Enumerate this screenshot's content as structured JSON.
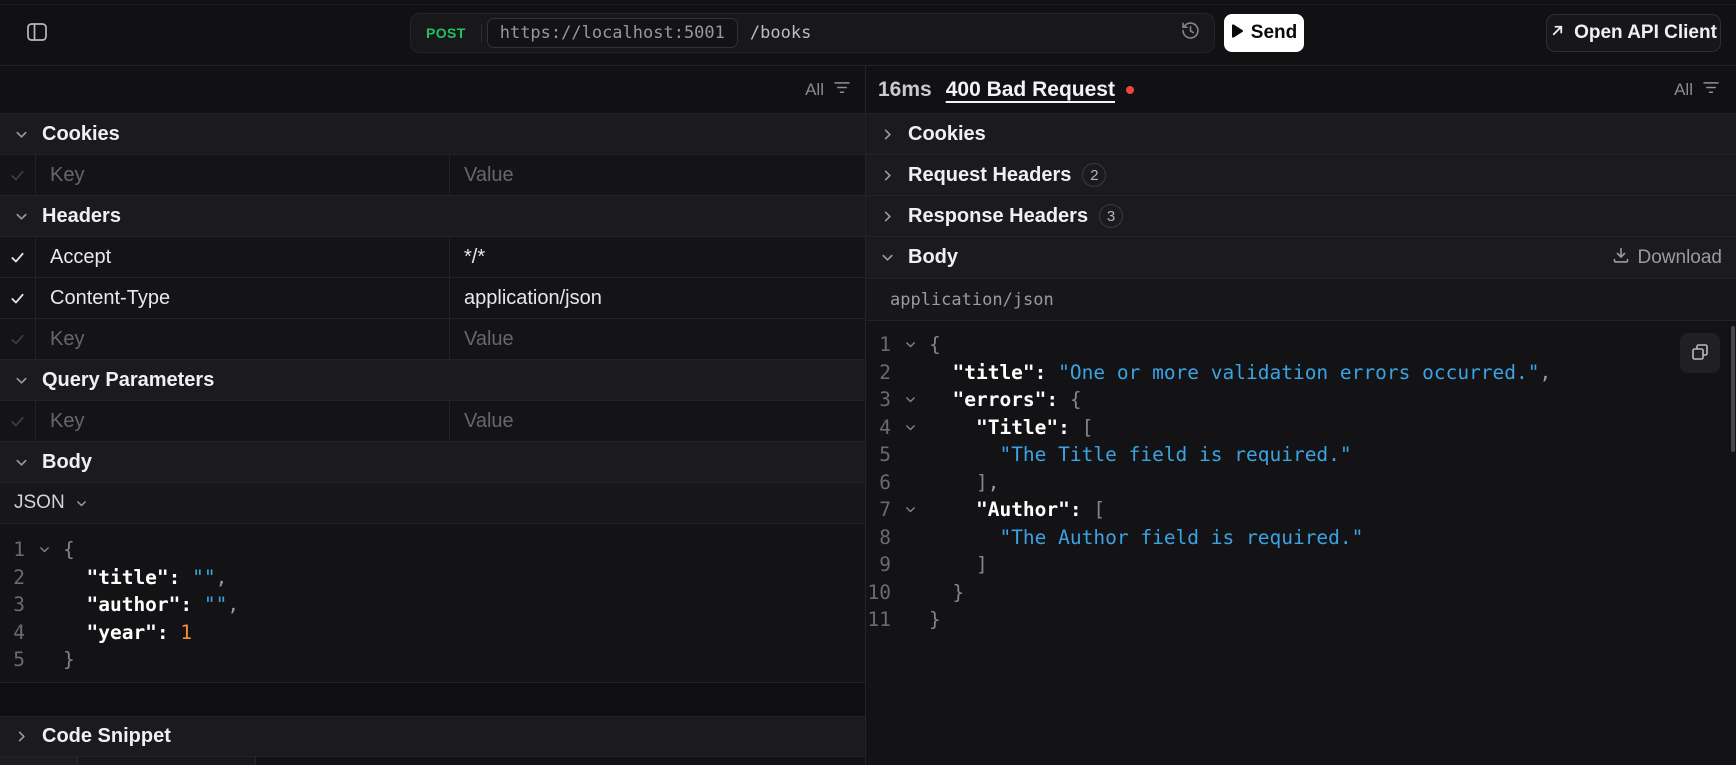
{
  "topbar": {
    "method": "POST",
    "base_url": "https://localhost:5001",
    "path": "/books",
    "send_label": "Send",
    "open_api_client_label": "Open API Client"
  },
  "request_panel": {
    "filter_label": "All",
    "placeholders": {
      "key": "Key",
      "value": "Value"
    },
    "sections": {
      "cookies": {
        "title": "Cookies",
        "rows": [
          {
            "key": "",
            "value": "",
            "checked": false
          }
        ]
      },
      "headers": {
        "title": "Headers",
        "rows": [
          {
            "key": "Accept",
            "value": "*/*",
            "checked": true
          },
          {
            "key": "Content-Type",
            "value": "application/json",
            "checked": true
          },
          {
            "key": "",
            "value": "",
            "checked": false
          }
        ]
      },
      "query_parameters": {
        "title": "Query Parameters",
        "rows": [
          {
            "key": "",
            "value": "",
            "checked": false
          }
        ]
      },
      "body": {
        "title": "Body",
        "format_selector": "JSON"
      },
      "code_snippet": {
        "title": "Code Snippet"
      }
    },
    "body_code": [
      {
        "n": 1,
        "fold": true,
        "ind": 0,
        "seg": [
          [
            "{",
            "brace"
          ]
        ]
      },
      {
        "n": 2,
        "ind": 2,
        "seg": [
          [
            "\"title\":",
            "key"
          ],
          [
            " ",
            "punc"
          ],
          [
            "\"\"",
            "str"
          ],
          [
            ",",
            "punc"
          ]
        ]
      },
      {
        "n": 3,
        "ind": 2,
        "seg": [
          [
            "\"author\":",
            "key"
          ],
          [
            " ",
            "punc"
          ],
          [
            "\"\"",
            "str"
          ],
          [
            ",",
            "punc"
          ]
        ]
      },
      {
        "n": 4,
        "ind": 2,
        "seg": [
          [
            "\"year\":",
            "key"
          ],
          [
            " ",
            "punc"
          ],
          [
            "1",
            "num"
          ]
        ]
      },
      {
        "n": 5,
        "ind": 0,
        "seg": [
          [
            "}",
            "brace"
          ]
        ]
      }
    ]
  },
  "response_panel": {
    "duration": "16ms",
    "status": "400 Bad Request",
    "filter_label": "All",
    "sections": {
      "cookies": {
        "title": "Cookies"
      },
      "request_headers": {
        "title": "Request Headers",
        "count": "2"
      },
      "response_headers": {
        "title": "Response Headers",
        "count": "3"
      },
      "body": {
        "title": "Body",
        "download_label": "Download",
        "content_type": "application/json"
      }
    },
    "body_code": [
      {
        "n": 1,
        "fold": true,
        "ind": 0,
        "seg": [
          [
            "{",
            "brace"
          ]
        ]
      },
      {
        "n": 2,
        "ind": 2,
        "seg": [
          [
            "\"title\":",
            "key"
          ],
          [
            " ",
            "punc"
          ],
          [
            "\"One or more validation errors occurred.\"",
            "str"
          ],
          [
            ",",
            "punc"
          ]
        ]
      },
      {
        "n": 3,
        "fold": true,
        "ind": 2,
        "seg": [
          [
            "\"errors\":",
            "key"
          ],
          [
            " ",
            "punc"
          ],
          [
            "{",
            "brace"
          ]
        ]
      },
      {
        "n": 4,
        "fold": true,
        "ind": 4,
        "seg": [
          [
            "\"Title\":",
            "key"
          ],
          [
            " ",
            "punc"
          ],
          [
            "[",
            "brace"
          ]
        ]
      },
      {
        "n": 5,
        "ind": 6,
        "seg": [
          [
            "\"The Title field is required.\"",
            "str"
          ]
        ]
      },
      {
        "n": 6,
        "ind": 4,
        "seg": [
          [
            "]",
            "brace"
          ],
          [
            ",",
            "punc"
          ]
        ]
      },
      {
        "n": 7,
        "fold": true,
        "ind": 4,
        "seg": [
          [
            "\"Author\":",
            "key"
          ],
          [
            " ",
            "punc"
          ],
          [
            "[",
            "brace"
          ]
        ]
      },
      {
        "n": 8,
        "ind": 6,
        "seg": [
          [
            "\"The Author field is required.\"",
            "str"
          ]
        ]
      },
      {
        "n": 9,
        "ind": 4,
        "seg": [
          [
            "]",
            "brace"
          ]
        ]
      },
      {
        "n": 10,
        "ind": 2,
        "seg": [
          [
            "}",
            "brace"
          ]
        ]
      },
      {
        "n": 11,
        "ind": 0,
        "seg": [
          [
            "}",
            "brace"
          ]
        ]
      }
    ]
  },
  "colors": {
    "method_green": "#21c063",
    "string_blue": "#3ba3e3",
    "number_orange": "#ef8e3b",
    "status_red": "#ef4444",
    "send_button_bg": "#ffffff"
  }
}
